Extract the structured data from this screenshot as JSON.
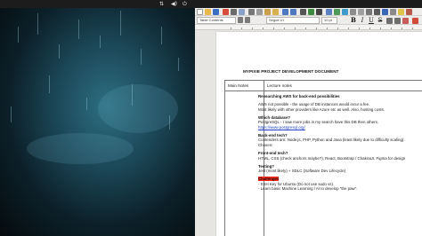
{
  "window": {
    "app": "LibreOffice Writer"
  },
  "toolbar": {
    "paragraph_style": "Table Contents",
    "font_name": "Segoe UI",
    "font_size": "10 pt",
    "bold_label": "B",
    "italic_label": "I",
    "underline_label": "U",
    "strike_label": "S"
  },
  "document": {
    "title": "MYPIXIE PROJECT DEVELOPMENT DOCUMENT",
    "col1_header": "Main Notes",
    "col2_header": "Lecture notes",
    "lines": [
      {
        "text": "Researching AWS for back-end possibilities",
        "style": "bold"
      },
      {
        "text": "",
        "style": ""
      },
      {
        "text": "AWS not possible - the usage of DB instances would incur a fee.",
        "style": ""
      },
      {
        "text": "Most likely with other providers like Azure etc as well. Also, hosting costs.",
        "style": ""
      },
      {
        "text": "",
        "style": ""
      },
      {
        "text": "Which database?",
        "style": "bold"
      },
      {
        "text": "PostgreSQL - I saw more jobs in my search have this DB then others.",
        "style": ""
      },
      {
        "text": "https://www.postgresql.org/",
        "style": "link"
      },
      {
        "text": "",
        "style": ""
      },
      {
        "text": "Back-end tech?",
        "style": "bold"
      },
      {
        "text": "Contenders are: Node.js, PHP, Python and Java (least likely due to difficulty scaling).",
        "style": ""
      },
      {
        "text": "Chosen:",
        "style": ""
      },
      {
        "text": "",
        "style": ""
      },
      {
        "text": "Front-end tech?",
        "style": "bold"
      },
      {
        "text": "HTML, CSS (check anchors maybe?), React, Bootstrap / ChakraUI, Figma for design",
        "style": ""
      },
      {
        "text": "",
        "style": ""
      },
      {
        "text": "Testing?",
        "style": "bold"
      },
      {
        "text": "Jest (most likely) + SDLC (Software Dev Lifecycle)",
        "style": ""
      },
      {
        "text": "",
        "style": ""
      },
      {
        "text": "Challenges",
        "style": "highlight"
      },
      {
        "text": "- SSH Key for Ubuntu (Do not use sudo vs).",
        "style": ""
      },
      {
        "text": "- Learn basic Machine Learning / AI to develop \"the paw\".",
        "style": ""
      }
    ]
  },
  "icons": {
    "topbar": [
      "network-icon",
      "volume-icon",
      "power-icon"
    ],
    "toolbar1": [
      "new-doc-icon",
      "open-icon",
      "save-icon",
      "export-pdf-icon",
      "print-icon",
      "print-preview-icon",
      "cut-icon",
      "copy-icon",
      "paste-icon",
      "clone-format-icon",
      "undo-icon",
      "redo-icon",
      "find-replace-icon",
      "spelling-icon",
      "formatting-marks-icon",
      "insert-table-icon",
      "insert-image-icon",
      "insert-chart-icon",
      "insert-text-box-icon",
      "insert-page-break-icon",
      "insert-field-icon",
      "insert-special-char-icon",
      "insert-hyperlink-icon",
      "insert-footnote-icon",
      "insert-comment-icon",
      "track-changes-icon"
    ]
  },
  "colors": {
    "highlight": "#ff2a1a",
    "link": "#1a3ec7"
  }
}
